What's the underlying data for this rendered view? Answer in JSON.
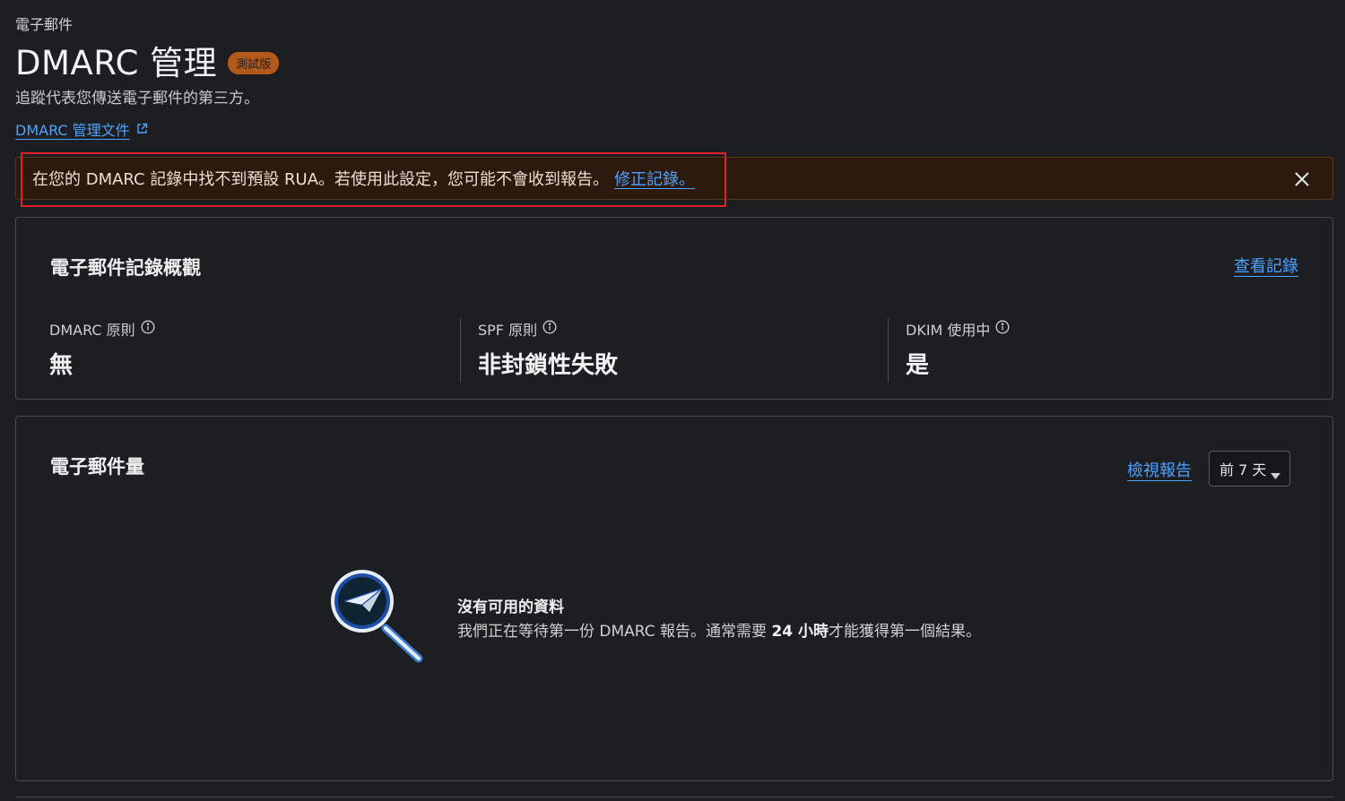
{
  "header": {
    "breadcrumb": "電子郵件",
    "title": "DMARC 管理",
    "badge": "測試版",
    "subtitle": "追蹤代表您傳送電子郵件的第三方。",
    "doc_link": "DMARC 管理文件",
    "doc_link_icon": "external-link-icon"
  },
  "alert": {
    "message": "在您的 DMARC 記錄中找不到預設 RUA。若使用此設定，您可能不會收到報告。",
    "fix_link": "修正記錄。",
    "close_icon": "close-icon"
  },
  "overview": {
    "title": "電子郵件記錄概觀",
    "view_link": "查看記錄",
    "stats": [
      {
        "label": "DMARC 原則",
        "value": "無"
      },
      {
        "label": "SPF 原則",
        "value": "非封鎖性失敗"
      },
      {
        "label": "DKIM 使用中",
        "value": "是"
      }
    ]
  },
  "volume": {
    "title": "電子郵件量",
    "report_link": "檢視報告",
    "range": "前 7 天",
    "empty_title": "沒有可用的資料",
    "empty_desc_before": "我們正在等待第一份 DMARC 報告。通常需要 ",
    "empty_desc_bold": "24 小時",
    "empty_desc_after": "才能獲得第一個結果。"
  },
  "colors": {
    "background": "#1d1e22",
    "link": "#4da3ff",
    "badge": "#b3591a",
    "alert_bg": "#2c1a0e",
    "highlight": "#e0202a"
  }
}
